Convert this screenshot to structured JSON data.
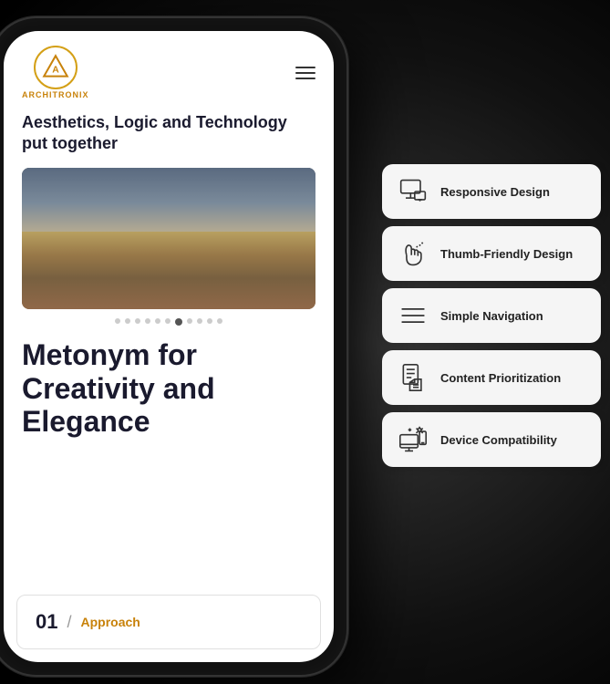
{
  "background": {
    "color": "#1a1a1a"
  },
  "phone": {
    "tagline": "Aesthetics, Logic and Technology put together",
    "main_heading": "Metonym for Creativity and Elegance",
    "logo_text": "ArchitroniX",
    "hero_alt": "Restaurant interior photo",
    "dots_count": 11,
    "active_dot": 6,
    "bottom_card": {
      "number": "01",
      "divider": "/",
      "label": "Approach"
    }
  },
  "features": [
    {
      "id": "responsive-design",
      "label": "Responsive Design",
      "icon": "monitor-icon"
    },
    {
      "id": "thumb-friendly",
      "label": "Thumb-Friendly Design",
      "icon": "hand-icon"
    },
    {
      "id": "simple-navigation",
      "label": "Simple Navigation",
      "icon": "menu-icon"
    },
    {
      "id": "content-prioritization",
      "label": "Content Prioritization",
      "icon": "document-icon"
    },
    {
      "id": "device-compatibility",
      "label": "Device Compatibility",
      "icon": "devices-icon"
    }
  ]
}
